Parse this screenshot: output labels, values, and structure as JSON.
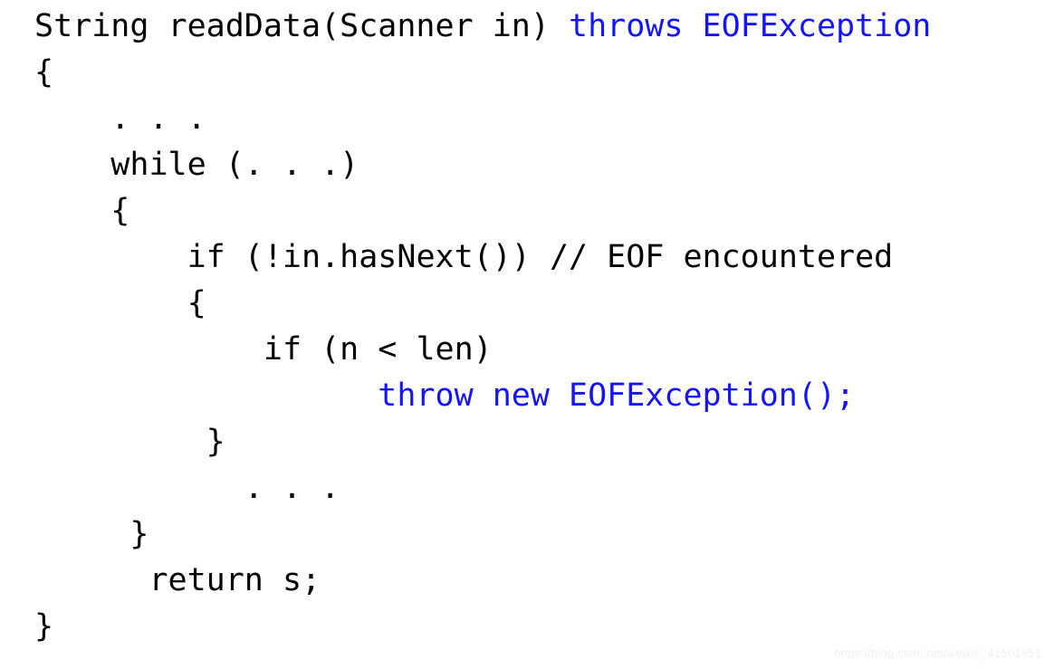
{
  "document": {
    "kind": "code-snippet",
    "language": "Java",
    "background_color": "#ffffff",
    "text_color": "#000000",
    "keyword_color": "#1414ff"
  },
  "code": {
    "lines": [
      {
        "id": "line-1",
        "indent": "",
        "segments": [
          {
            "text": "String readData(Scanner in) ",
            "style": "plain"
          },
          {
            "text": "throws EOFException",
            "style": "keyword"
          }
        ]
      },
      {
        "id": "line-2",
        "indent": "",
        "segments": [
          {
            "text": "{",
            "style": "plain"
          }
        ]
      },
      {
        "id": "line-3",
        "indent": "    ",
        "segments": [
          {
            "text": ". . .",
            "style": "plain"
          }
        ]
      },
      {
        "id": "line-4",
        "indent": "    ",
        "segments": [
          {
            "text": "while (. . .)",
            "style": "plain"
          }
        ]
      },
      {
        "id": "line-5",
        "indent": "    ",
        "segments": [
          {
            "text": "{",
            "style": "plain"
          }
        ]
      },
      {
        "id": "line-6",
        "indent": "        ",
        "segments": [
          {
            "text": "if (!in.hasNext()) ",
            "style": "plain"
          },
          {
            "text": "// EOF encountered",
            "style": "comment"
          }
        ]
      },
      {
        "id": "line-7",
        "indent": "        ",
        "segments": [
          {
            "text": "{",
            "style": "plain"
          }
        ]
      },
      {
        "id": "line-8",
        "indent": "            ",
        "segments": [
          {
            "text": "if (n < len)",
            "style": "plain"
          }
        ]
      },
      {
        "id": "line-9",
        "indent": "                  ",
        "segments": [
          {
            "text": "throw new EOFException();",
            "style": "keyword"
          }
        ]
      },
      {
        "id": "line-10",
        "indent": "         ",
        "segments": [
          {
            "text": "}",
            "style": "plain"
          }
        ]
      },
      {
        "id": "line-11",
        "indent": "           ",
        "segments": [
          {
            "text": ". . .",
            "style": "plain"
          }
        ]
      },
      {
        "id": "line-12",
        "indent": "     ",
        "segments": [
          {
            "text": "}",
            "style": "plain"
          }
        ]
      },
      {
        "id": "line-13",
        "indent": "      ",
        "segments": [
          {
            "text": "return s;",
            "style": "plain"
          }
        ]
      },
      {
        "id": "line-14",
        "indent": "",
        "segments": [
          {
            "text": "}",
            "style": "plain"
          }
        ]
      }
    ]
  },
  "watermark": {
    "text": "https://blog.csdn.net/weixin_41501951"
  }
}
